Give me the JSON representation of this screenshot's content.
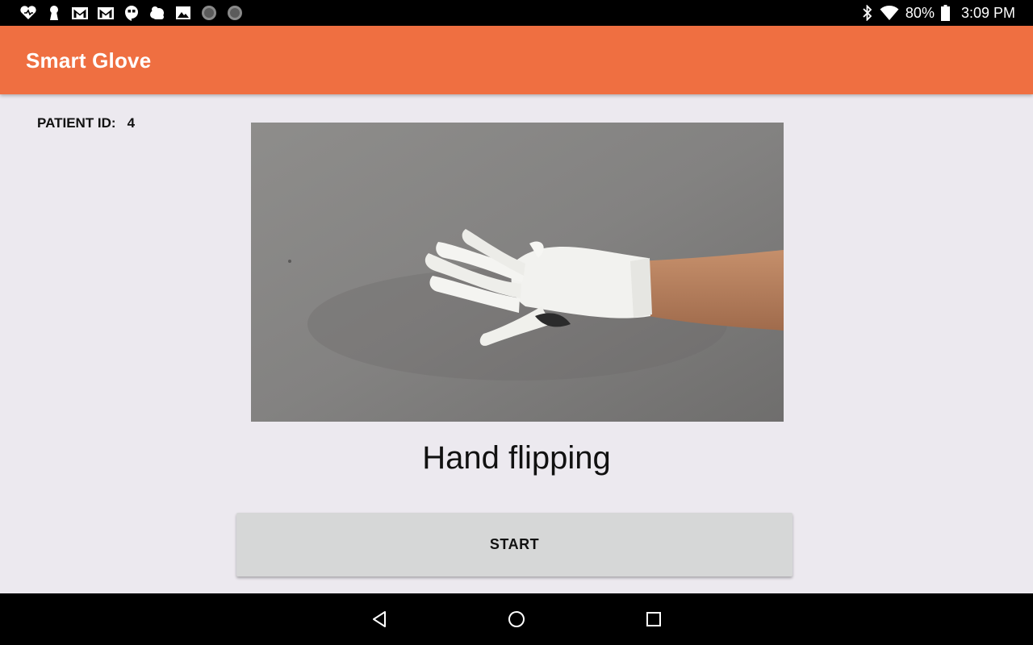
{
  "status_bar": {
    "notification_icons": [
      "heart-app-icon",
      "keyhole-icon",
      "gmail-icon",
      "gmail-icon",
      "hangouts-icon",
      "weather-icon",
      "gallery-icon",
      "dot-icon",
      "dot-icon"
    ],
    "battery": "80%",
    "time": "3:09 PM"
  },
  "app_bar": {
    "title": "Smart Glove",
    "color": "#ef6f41"
  },
  "patient": {
    "label": "PATIENT ID:",
    "value": "4"
  },
  "exercise": {
    "media": "white glove hand flipping",
    "name": "Hand flipping"
  },
  "actions": {
    "start_label": "START"
  },
  "nav": {
    "buttons": [
      "back-icon",
      "home-icon",
      "recents-icon"
    ]
  }
}
